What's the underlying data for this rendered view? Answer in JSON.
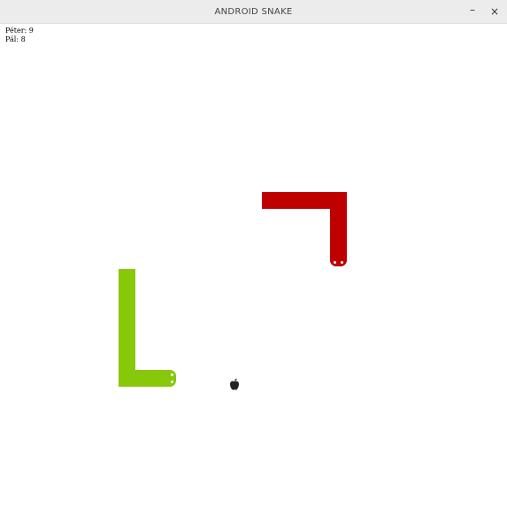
{
  "window": {
    "title": "ANDROID SNAKE",
    "minimize_glyph": "–",
    "close_glyph": "×"
  },
  "scores": [
    {
      "name": "Péter",
      "value": "9"
    },
    {
      "name": "Pál",
      "value": "8"
    }
  ],
  "snakes": [
    {
      "color": "#be0000",
      "heading": "down"
    },
    {
      "color": "#88c80a",
      "heading": "right"
    }
  ],
  "apple": {
    "icon": "apple-icon",
    "color": "#222222"
  }
}
